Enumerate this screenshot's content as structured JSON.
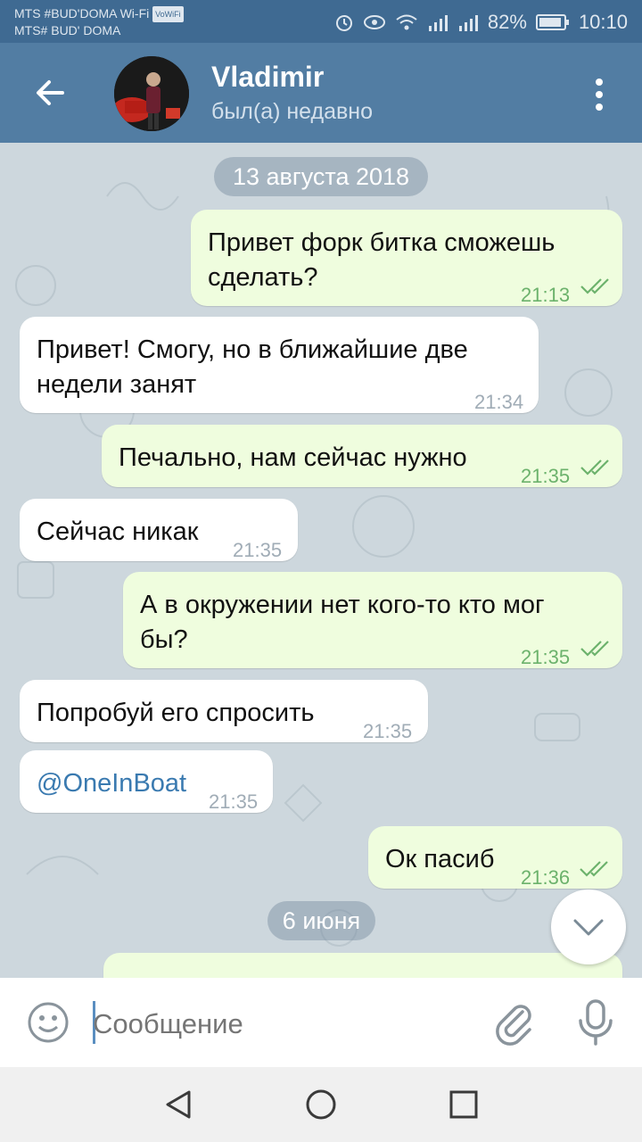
{
  "status_bar": {
    "carrier_line1": "MTS #BUD'DOMA Wi-Fi",
    "vowifi_badge": "VoWiFi",
    "carrier_line2": "MTS# BUD' DOMA",
    "battery": "82%",
    "time": "10:10"
  },
  "header": {
    "name": "Vladimir",
    "status": "был(а) недавно"
  },
  "chat": {
    "date_1": "13 августа 2018",
    "date_2": "6 июня",
    "messages": [
      {
        "direction": "out",
        "line1": "Привет форк битка сможешь",
        "line2": "сделать?",
        "time": "21:13",
        "read": true
      },
      {
        "direction": "in",
        "line1": "Привет! Смогу, но в ближайшие две",
        "line2": "недели занят",
        "time": "21:34"
      },
      {
        "direction": "out",
        "line1": "Печально, нам сейчас нужно",
        "time": "21:35",
        "read": true
      },
      {
        "direction": "in",
        "line1": "Сейчас никак",
        "time": "21:35"
      },
      {
        "direction": "out",
        "line1": "А в окружении нет кого-то кто мог",
        "line2": "бы?",
        "time": "21:35",
        "read": true
      },
      {
        "direction": "in",
        "line1": "Попробуй его спросить",
        "time": "21:35"
      },
      {
        "direction": "in",
        "line1": "@OneInBoat",
        "time": "21:35"
      },
      {
        "direction": "out",
        "line1": "Ок пасиб",
        "time": "21:36",
        "read": true
      }
    ]
  },
  "composer": {
    "placeholder": "Сообщение"
  },
  "icons": {
    "back": "arrow-back-icon",
    "menu": "more-vert-icon",
    "scroll_down": "chevron-down-icon",
    "emoji": "smiley-icon",
    "attach": "paperclip-icon",
    "mic": "microphone-icon"
  },
  "colors": {
    "appbar": "#527da3",
    "statusbar": "#3f6a92",
    "bubble_out": "#effdde",
    "bubble_in": "#ffffff",
    "read_check": "#6cb26c"
  }
}
